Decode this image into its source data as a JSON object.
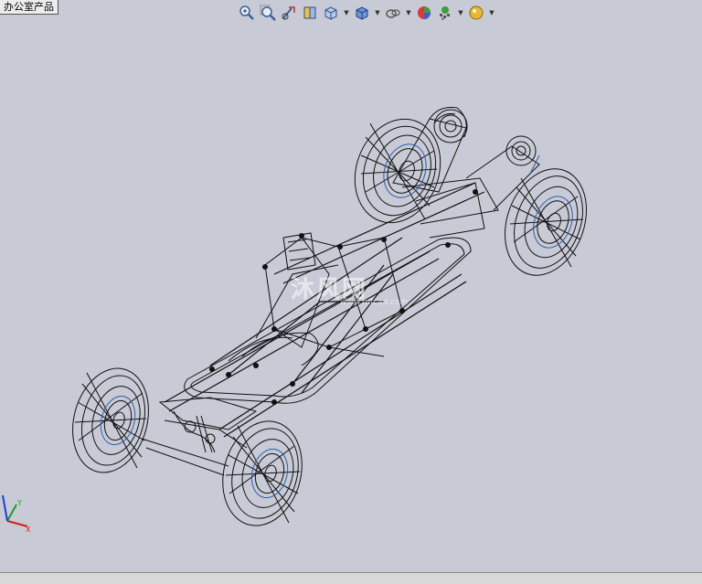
{
  "tree_tab": {
    "label": "办公室产品"
  },
  "toolbar": {
    "items": [
      {
        "name": "zoom-to-fit-icon"
      },
      {
        "name": "zoom-to-area-icon"
      },
      {
        "name": "previous-view-icon"
      },
      {
        "name": "section-view-icon"
      },
      {
        "name": "view-orientation-icon",
        "dropdown": true
      },
      {
        "name": "display-style-icon",
        "dropdown": true
      },
      {
        "name": "hide-show-items-icon",
        "dropdown": true
      },
      {
        "name": "edit-appearance-icon"
      },
      {
        "name": "apply-scene-icon",
        "dropdown": true
      },
      {
        "name": "view-settings-icon",
        "dropdown": true
      }
    ]
  },
  "watermark": {
    "text": "沐风网",
    "sub": "www.mfcad.com"
  },
  "triad": {
    "x_label": "X",
    "y_label": "Y",
    "x_color": "#d81b1b",
    "y_color": "#1b9e1b",
    "z_color": "#1b3fd8"
  },
  "colors": {
    "background": "#c8cbd5",
    "wire": "#111111",
    "wire_accent": "#2a5db0"
  }
}
